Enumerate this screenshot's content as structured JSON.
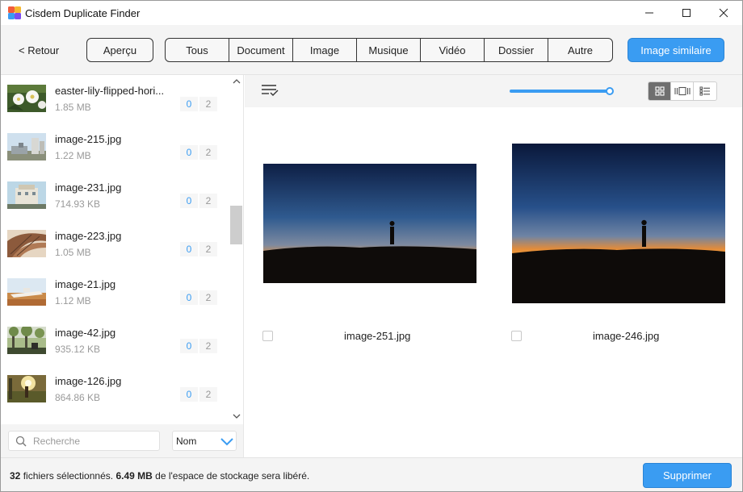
{
  "window": {
    "title": "Cisdem Duplicate Finder"
  },
  "toolbar": {
    "back_label": "< Retour",
    "preview_label": "Aperçu",
    "filters": [
      "Tous",
      "Document",
      "Image",
      "Musique",
      "Vidéo",
      "Dossier",
      "Autre"
    ],
    "similar_label": "Image similaire"
  },
  "file_list": [
    {
      "name": "easter-lily-flipped-hori...",
      "size": "1.85 MB",
      "selected": "0",
      "total": "2"
    },
    {
      "name": "image-215.jpg",
      "size": "1.22 MB",
      "selected": "0",
      "total": "2"
    },
    {
      "name": "image-231.jpg",
      "size": "714.93 KB",
      "selected": "0",
      "total": "2"
    },
    {
      "name": "image-223.jpg",
      "size": "1.05 MB",
      "selected": "0",
      "total": "2"
    },
    {
      "name": "image-21.jpg",
      "size": "1.12 MB",
      "selected": "0",
      "total": "2"
    },
    {
      "name": "image-42.jpg",
      "size": "935.12 KB",
      "selected": "0",
      "total": "2"
    },
    {
      "name": "image-126.jpg",
      "size": "864.86 KB",
      "selected": "0",
      "total": "2"
    }
  ],
  "search": {
    "placeholder": "Recherche"
  },
  "sort": {
    "selected": "Nom"
  },
  "zoom": {
    "level_percent": 100
  },
  "view_modes": [
    "grid-view-icon",
    "carousel-view-icon",
    "list-view-icon"
  ],
  "photos": [
    {
      "name": "image-251.jpg",
      "checked": false
    },
    {
      "name": "image-246.jpg",
      "checked": false
    }
  ],
  "status": {
    "count": "32",
    "count_text": "fichiers sélectionnés.",
    "size": "6.49 MB",
    "size_text": "de l'espace de stockage sera libéré."
  },
  "actions": {
    "delete_label": "Supprimer"
  },
  "colors": {
    "accent": "#3a9cf2",
    "toolbar_bg": "#f4f4f4"
  }
}
